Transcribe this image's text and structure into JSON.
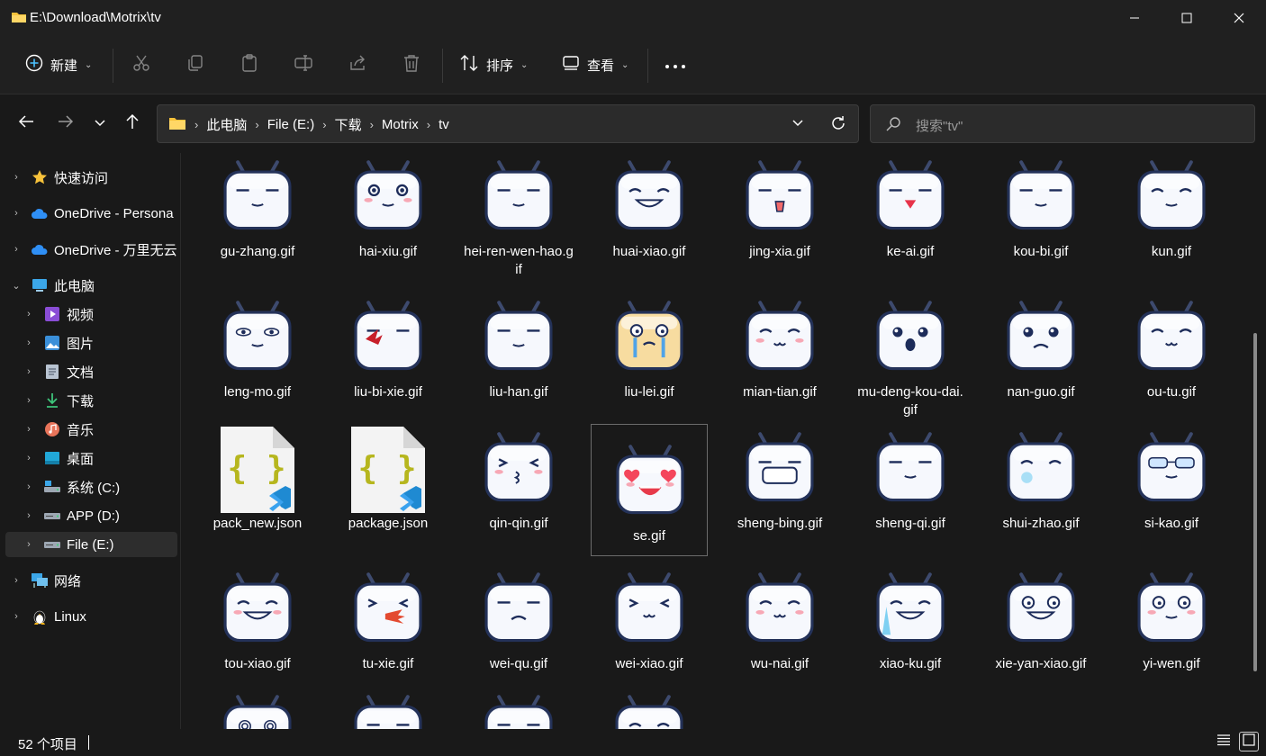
{
  "window": {
    "title": "E:\\Download\\Motrix\\tv"
  },
  "toolbar": {
    "new_label": "新建",
    "sort_label": "排序",
    "view_label": "查看"
  },
  "breadcrumb": [
    "此电脑",
    "File (E:)",
    "下载",
    "Motrix",
    "tv"
  ],
  "search": {
    "placeholder": "搜索\"tv\""
  },
  "sidebar": {
    "items": [
      {
        "label": "快速访问",
        "icon": "star-icon",
        "level": 0,
        "expander": "›"
      },
      {
        "label": "OneDrive - Persona",
        "icon": "onedrive-cloud-icon",
        "level": 0,
        "expander": "›"
      },
      {
        "label": "OneDrive - 万里无云",
        "icon": "onedrive-cloud-icon",
        "level": 0,
        "expander": "›"
      },
      {
        "label": "此电脑",
        "icon": "this-pc-icon",
        "level": 0,
        "expander": "⌄"
      },
      {
        "label": "视频",
        "icon": "videos-folder-icon",
        "level": 1,
        "expander": "›"
      },
      {
        "label": "图片",
        "icon": "pictures-folder-icon",
        "level": 1,
        "expander": "›"
      },
      {
        "label": "文档",
        "icon": "documents-folder-icon",
        "level": 1,
        "expander": "›"
      },
      {
        "label": "下载",
        "icon": "downloads-folder-icon",
        "level": 1,
        "expander": "›"
      },
      {
        "label": "音乐",
        "icon": "music-folder-icon",
        "level": 1,
        "expander": "›"
      },
      {
        "label": "桌面",
        "icon": "desktop-folder-icon",
        "level": 1,
        "expander": "›"
      },
      {
        "label": "系统 (C:)",
        "icon": "system-drive-icon",
        "level": 1,
        "expander": "›"
      },
      {
        "label": "APP (D:)",
        "icon": "drive-icon",
        "level": 1,
        "expander": "›"
      },
      {
        "label": "File (E:)",
        "icon": "drive-icon",
        "level": 1,
        "expander": "›",
        "selected": true
      },
      {
        "label": "网络",
        "icon": "network-icon",
        "level": 0,
        "expander": "›"
      },
      {
        "label": "Linux",
        "icon": "linux-penguin-icon",
        "level": 0,
        "expander": "›"
      }
    ]
  },
  "files": [
    {
      "name": "gu-zhang.gif",
      "face": "smug",
      "kind": "gif"
    },
    {
      "name": "hai-xiu.gif",
      "face": "shy",
      "kind": "gif"
    },
    {
      "name": "hei-ren-wen-hao.gif",
      "face": "flat",
      "kind": "gif"
    },
    {
      "name": "huai-xiao.gif",
      "face": "grin",
      "kind": "gif"
    },
    {
      "name": "jing-xia.gif",
      "face": "shock",
      "kind": "gif"
    },
    {
      "name": "ke-ai.gif",
      "face": "cute",
      "kind": "gif"
    },
    {
      "name": "kou-bi.gif",
      "face": "pick",
      "kind": "gif"
    },
    {
      "name": "kun.gif",
      "face": "sleepy",
      "kind": "gif"
    },
    {
      "name": "leng-mo.gif",
      "face": "cold",
      "kind": "gif"
    },
    {
      "name": "liu-bi-xie.gif",
      "face": "bleed",
      "kind": "gif"
    },
    {
      "name": "liu-han.gif",
      "face": "sweat",
      "kind": "gif"
    },
    {
      "name": "liu-lei.gif",
      "face": "cry-yellow",
      "kind": "gif"
    },
    {
      "name": "mian-tian.gif",
      "face": "blush",
      "kind": "gif"
    },
    {
      "name": "mu-deng-kou-dai.gif",
      "face": "stunned",
      "kind": "gif"
    },
    {
      "name": "nan-guo.gif",
      "face": "sad",
      "kind": "gif"
    },
    {
      "name": "ou-tu.gif",
      "face": "sick",
      "kind": "gif"
    },
    {
      "name": "pack_new.json",
      "face": "",
      "kind": "json"
    },
    {
      "name": "package.json",
      "face": "",
      "kind": "json"
    },
    {
      "name": "qin-qin.gif",
      "face": "kiss",
      "kind": "gif"
    },
    {
      "name": "se.gif",
      "face": "hearts",
      "kind": "gif",
      "selected": true
    },
    {
      "name": "sheng-bing.gif",
      "face": "mask",
      "kind": "gif"
    },
    {
      "name": "sheng-qi.gif",
      "face": "angry",
      "kind": "gif"
    },
    {
      "name": "shui-zhao.gif",
      "face": "sleep",
      "kind": "gif"
    },
    {
      "name": "si-kao.gif",
      "face": "think",
      "kind": "gif"
    },
    {
      "name": "tou-xiao.gif",
      "face": "giggle",
      "kind": "gif"
    },
    {
      "name": "tu-xie.gif",
      "face": "vomit",
      "kind": "gif"
    },
    {
      "name": "wei-qu.gif",
      "face": "wronged",
      "kind": "gif"
    },
    {
      "name": "wei-xiao.gif",
      "face": "smile",
      "kind": "gif"
    },
    {
      "name": "wu-nai.gif",
      "face": "helpless",
      "kind": "gif"
    },
    {
      "name": "xiao-ku.gif",
      "face": "laughcry",
      "kind": "gif"
    },
    {
      "name": "xie-yan-xiao.gif",
      "face": "smirk",
      "kind": "gif"
    },
    {
      "name": "yi-wen.gif",
      "face": "question",
      "kind": "gif"
    },
    {
      "name": "",
      "face": "dizzy",
      "kind": "gif"
    },
    {
      "name": "",
      "face": "flat",
      "kind": "gif"
    },
    {
      "name": "",
      "face": "frown",
      "kind": "gif"
    },
    {
      "name": "",
      "face": "blush",
      "kind": "gif"
    }
  ],
  "status": {
    "item_count": "52 个项目"
  },
  "colors": {
    "background": "#191919",
    "chrome": "#202020",
    "accent": "#4cc2ff",
    "folder": "#f8c23a"
  }
}
